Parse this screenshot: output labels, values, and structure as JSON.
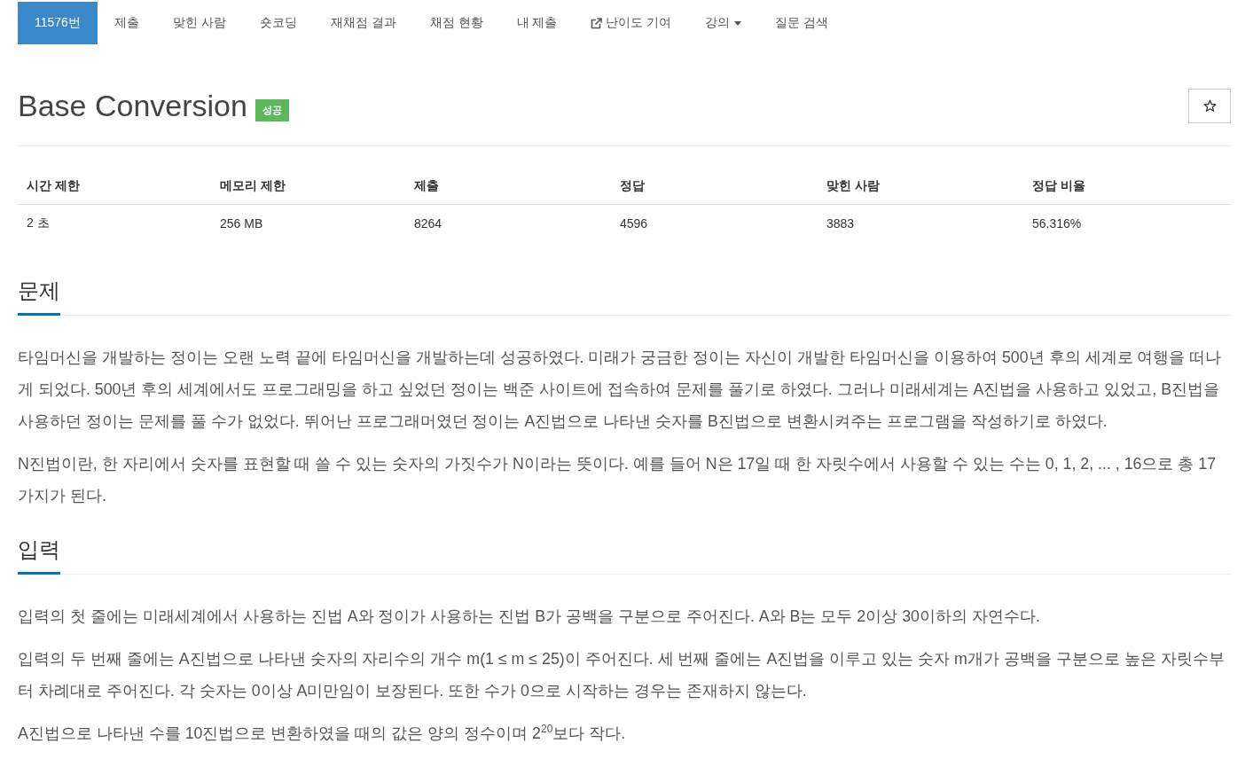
{
  "nav": {
    "tabs": [
      {
        "label": "11576번",
        "selected": true,
        "kind": "plain"
      },
      {
        "label": "제출",
        "selected": false,
        "kind": "plain"
      },
      {
        "label": "맞힌 사람",
        "selected": false,
        "kind": "plain"
      },
      {
        "label": "숏코딩",
        "selected": false,
        "kind": "plain"
      },
      {
        "label": "재채점 결과",
        "selected": false,
        "kind": "plain"
      },
      {
        "label": "채점 현황",
        "selected": false,
        "kind": "plain"
      },
      {
        "label": "내 제출",
        "selected": false,
        "kind": "plain"
      },
      {
        "label": "난이도 기여",
        "selected": false,
        "kind": "external"
      },
      {
        "label": "강의",
        "selected": false,
        "kind": "dropdown"
      },
      {
        "label": "질문 검색",
        "selected": false,
        "kind": "plain"
      }
    ]
  },
  "title": {
    "text": "Base Conversion",
    "badge": "성공"
  },
  "info_table": {
    "columns": [
      "시간 제한",
      "메모리 제한",
      "제출",
      "정답",
      "맞힌 사람",
      "정답 비율"
    ],
    "rows": [
      [
        "2 초",
        "256 MB",
        "8264",
        "4596",
        "3883",
        "56.316%"
      ]
    ]
  },
  "sections": [
    {
      "heading": "문제",
      "paragraphs": [
        "타임머신을 개발하는 정이는 오랜 노력 끝에 타임머신을 개발하는데 성공하였다. 미래가 궁금한 정이는 자신이 개발한 타임머신을 이용하여 500년 후의 세계로 여행을 떠나게 되었다. 500년 후의 세계에서도 프로그래밍을 하고 싶었던 정이는 백준 사이트에 접속하여 문제를 풀기로 하였다. 그러나 미래세계는 A진법을 사용하고 있었고, B진법을 사용하던 정이는 문제를 풀 수가 없었다. 뛰어난 프로그래머였던 정이는 A진법으로 나타낸 숫자를 B진법으로 변환시켜주는 프로그램을 작성하기로 하였다.",
        "N진법이란, 한 자리에서 숫자를 표현할 때 쓸 수 있는 숫자의 가짓수가 N이라는 뜻이다. 예를 들어 N은 17일 때 한 자릿수에서 사용할 수 있는 수는 0, 1, 2, ... , 16으로 총 17가지가 된다."
      ]
    },
    {
      "heading": "입력",
      "paragraphs": [
        "입력의 첫 줄에는 미래세계에서 사용하는 진법 A와 정이가 사용하는 진법 B가 공백을 구분으로 주어진다. A와 B는 모두 2이상 30이하의 자연수다.",
        "입력의 두 번째 줄에는 A진법으로 나타낸 숫자의 자리수의 개수 m(1 ≤ m ≤ 25)이 주어진다. 세 번째 줄에는 A진법을 이루고 있는 숫자 m개가 공백을 구분으로 높은 자릿수부터 차례대로 주어진다. 각 숫자는 0이상 A미만임이 보장된다. 또한 수가 0으로 시작하는 경우는 존재하지 않는다.",
        "A진법으로 나타낸 수를 10진법으로 변환하였을 때의 값은 양의 정수이며 2$^{20}$보다 작다."
      ]
    }
  ]
}
